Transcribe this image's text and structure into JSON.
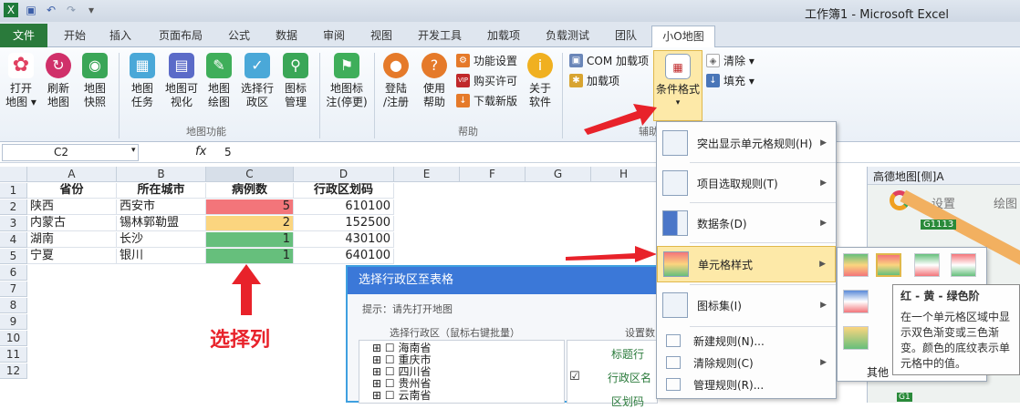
{
  "window": {
    "title": "工作簿1 - Microsoft Excel"
  },
  "quick_access": [
    "save-icon",
    "undo-icon",
    "redo-icon"
  ],
  "tabs": [
    "文件",
    "开始",
    "插入",
    "页面布局",
    "公式",
    "数据",
    "审阅",
    "视图",
    "开发工具",
    "加载项",
    "负载测试",
    "团队",
    "小O地图"
  ],
  "ribbon": {
    "buttons": [
      {
        "label": "打开\n地图 ▾",
        "color": "#e04060",
        "icon": "flower-icon"
      },
      {
        "label": "刷新\n地图",
        "color": "#d0306a",
        "icon": "refresh-icon"
      },
      {
        "label": "地图\n快照",
        "color": "#3aa657",
        "icon": "camera-icon"
      },
      {
        "label": "地图\n任务",
        "color": "#4aa8d8",
        "icon": "calendar-icon"
      },
      {
        "label": "地图可\n视化",
        "color": "#5b6bc8",
        "icon": "chart-icon"
      },
      {
        "label": "地图\n绘图",
        "color": "#3fae5a",
        "icon": "pencil-icon"
      },
      {
        "label": "选择行\n政区",
        "color": "#4aa8d8",
        "icon": "check-icon"
      },
      {
        "label": "图标\n管理",
        "color": "#3aa657",
        "icon": "pin-icon"
      },
      {
        "label": "地图标\n注(停更)",
        "color": "#3fae5a",
        "icon": "flag-icon"
      },
      {
        "label": "登陆\n/注册",
        "color": "#e57a2a",
        "icon": "user-icon"
      },
      {
        "label": "使用\n帮助",
        "color": "#e57a2a",
        "icon": "help-icon"
      },
      {
        "label": "关于\n软件",
        "color": "#f0b020",
        "icon": "info-icon"
      }
    ],
    "small": [
      "功能设置",
      "购买许可",
      "下载新版"
    ],
    "com": [
      "COM 加载项",
      "加载项"
    ],
    "condfmt": "条件格式",
    "clear": "清除 ▾",
    "fill": "填充 ▾",
    "groups": [
      "地图功能",
      "帮助",
      "辅助"
    ]
  },
  "formula": {
    "cell": "C2",
    "fx": "fx",
    "value": "5"
  },
  "columns": [
    "A",
    "B",
    "C",
    "D",
    "E",
    "F",
    "G",
    "H"
  ],
  "rows": [
    "1",
    "2",
    "3",
    "4",
    "5",
    "6",
    "7",
    "8",
    "9",
    "10",
    "11",
    "12"
  ],
  "table": {
    "headers": [
      "省份",
      "所在城市",
      "病例数",
      "行政区划码"
    ],
    "data": [
      [
        "陕西",
        "西安市",
        "5",
        "610100"
      ],
      [
        "内蒙古",
        "锡林郭勒盟",
        "2",
        "152500"
      ],
      [
        "湖南",
        "长沙",
        "1",
        "430100"
      ],
      [
        "宁夏",
        "银川",
        "1",
        "640100"
      ]
    ],
    "fill_colors": [
      "#f3757a",
      "#fbd57f",
      "#66bf7c",
      "#66bf7c"
    ]
  },
  "annotation": "选择列",
  "dialog": {
    "title": "选择行政区至表格",
    "hint": "提示：请先打开地图",
    "left_header": "选择行政区（鼠标右键批量）",
    "right_header": "设置数",
    "provinces": [
      "海南省",
      "重庆市",
      "四川省",
      "贵州省",
      "云南省"
    ],
    "fields": [
      "标题行",
      "行政区名",
      "区划码"
    ]
  },
  "menu": {
    "items": [
      {
        "label": "突出显示单元格规则(H)",
        "arrow": "▶"
      },
      {
        "label": "项目选取规则(T)",
        "arrow": "▶"
      },
      {
        "label": "数据条(D)",
        "arrow": "▶"
      },
      {
        "label": "单元格样式",
        "arrow": "▶"
      },
      {
        "label": "图标集(I)",
        "arrow": "▶"
      }
    ],
    "small_items": [
      {
        "label": "新建规则(N)..."
      },
      {
        "label": "清除规则(C)",
        "arrow": "▶"
      },
      {
        "label": "管理规则(R)..."
      }
    ]
  },
  "submenu": {
    "other": "其他"
  },
  "tooltip": {
    "title": "红 - 黄 - 绿色阶",
    "body": "在一个单元格区域中显示双色渐变或三色渐变。颜色的底纹表示单元格中的值。"
  },
  "map_panel": {
    "title": "高德地图[侧]A",
    "settings": "设置",
    "draw": "绘图",
    "road": "G1113",
    "road2": "G1"
  }
}
